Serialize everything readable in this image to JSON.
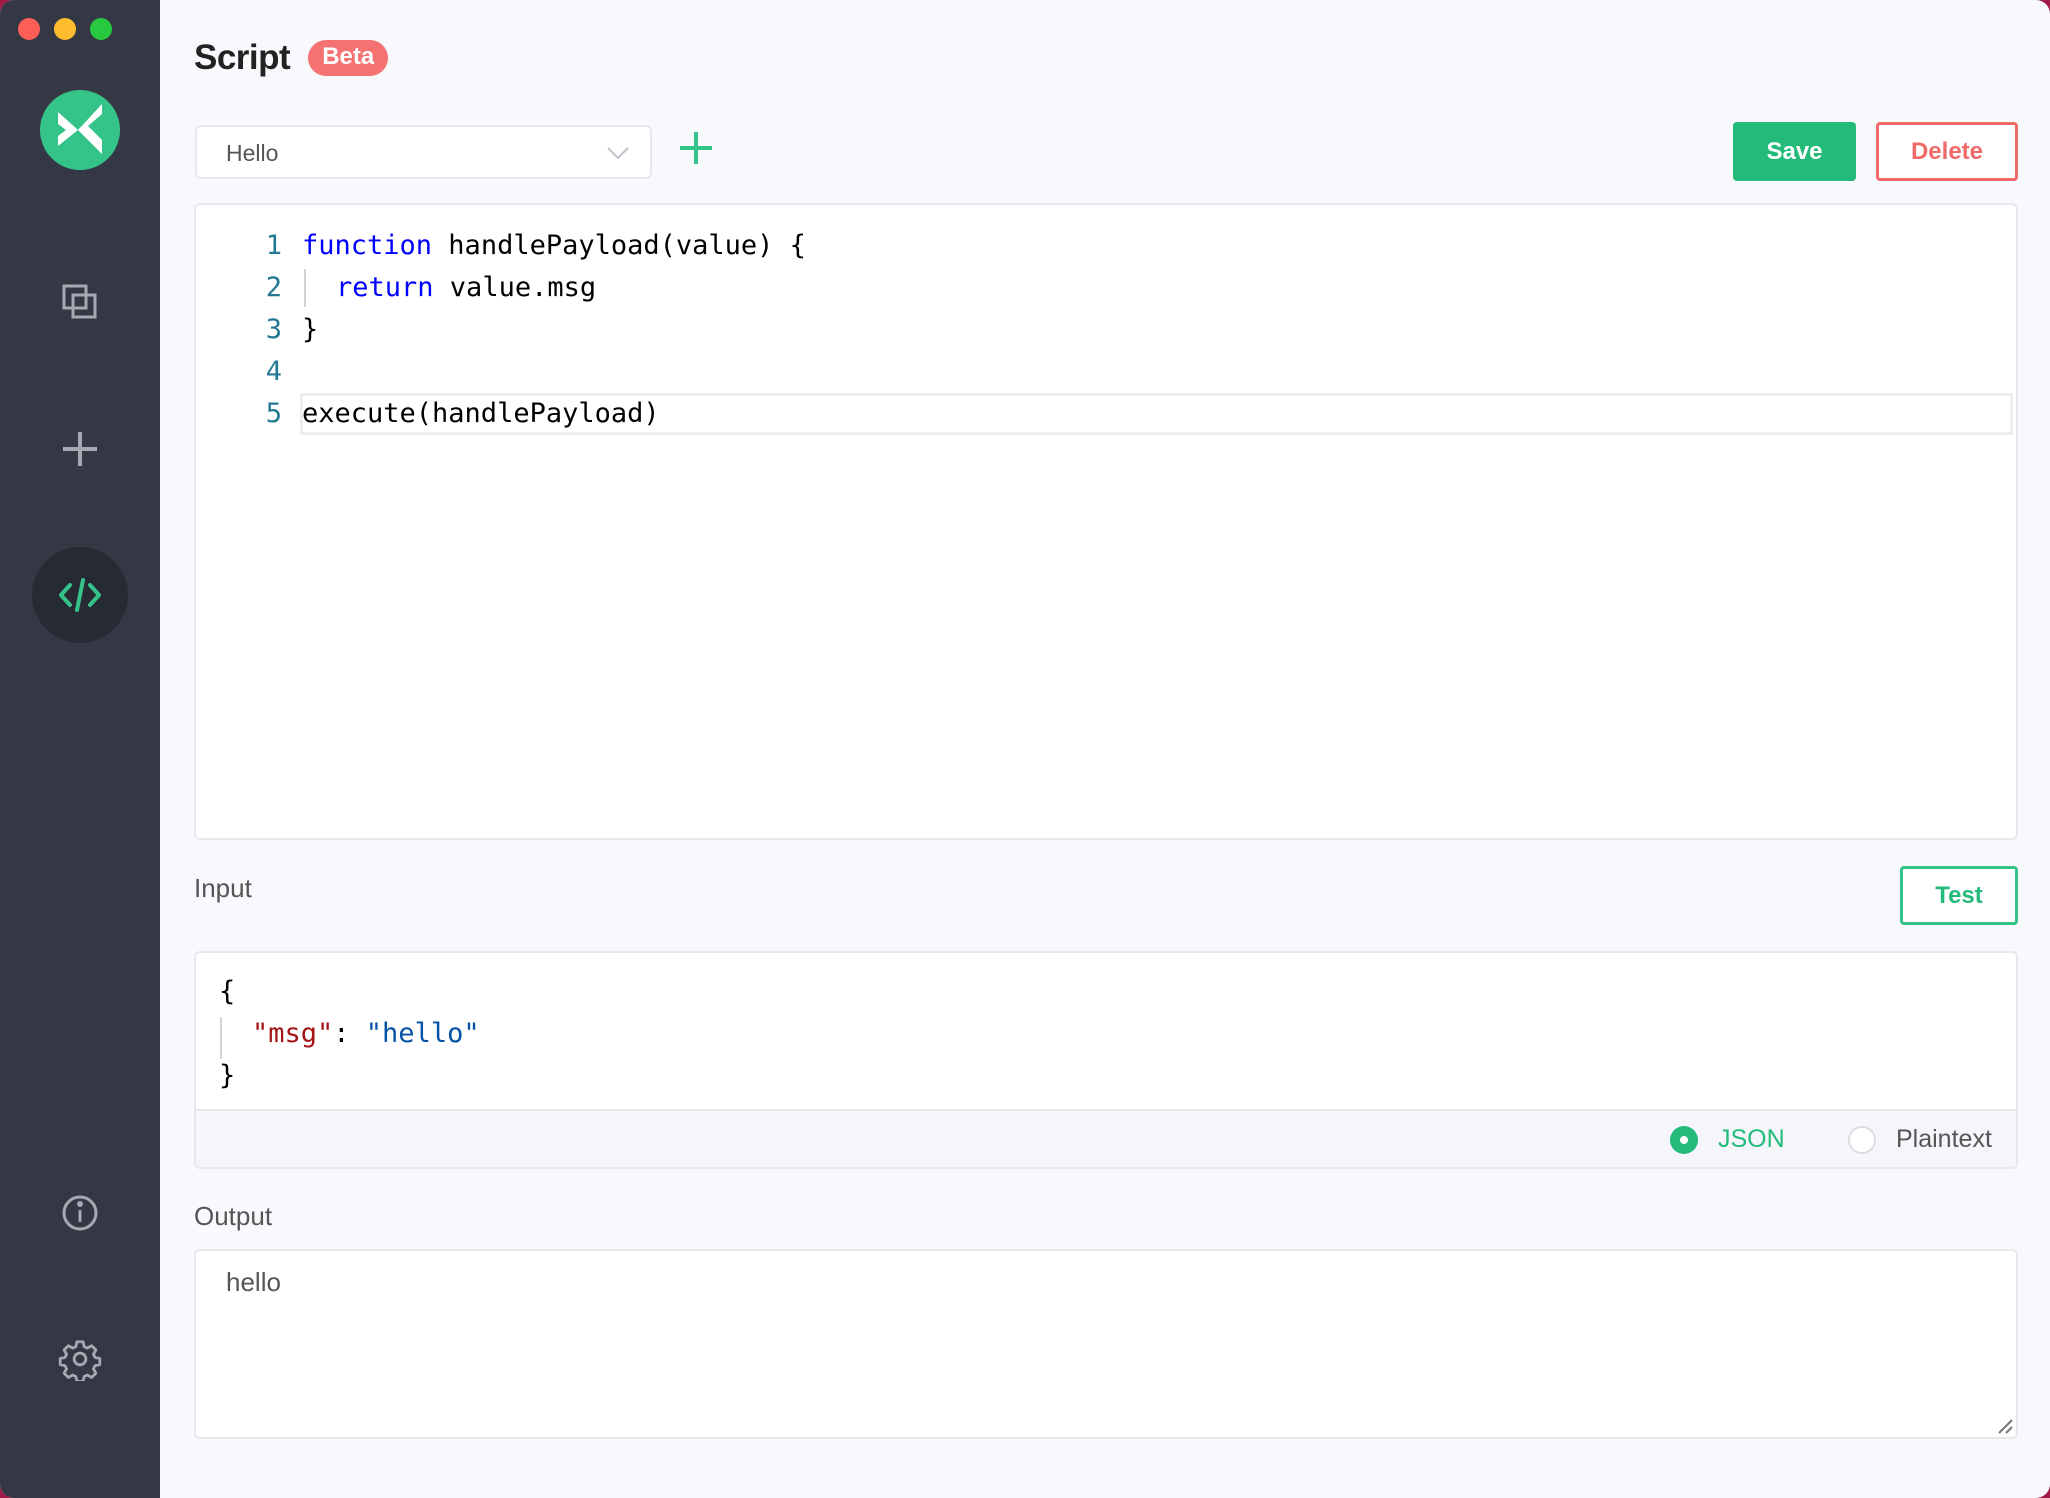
{
  "window": {
    "controls": [
      "close",
      "minimize",
      "maximize"
    ]
  },
  "sidebar": {
    "logo_icon": "mqttx-logo-icon",
    "items": [
      {
        "name": "connections",
        "icon": "copy-windows-icon",
        "active": false
      },
      {
        "name": "new-connection",
        "icon": "plus-icon",
        "active": false
      },
      {
        "name": "script",
        "icon": "code-icon",
        "active": true
      },
      {
        "name": "about",
        "icon": "info-icon",
        "active": false
      },
      {
        "name": "settings",
        "icon": "gear-icon",
        "active": false
      }
    ]
  },
  "header": {
    "title": "Script",
    "badge": "Beta"
  },
  "toolbar": {
    "script_select_value": "Hello",
    "add_icon": "plus-icon",
    "save_label": "Save",
    "delete_label": "Delete"
  },
  "editor": {
    "lines": [
      {
        "num": "1",
        "kw": "function",
        "rest": " handlePayload(value) {"
      },
      {
        "num": "2",
        "kw": "return",
        "rest": " value.msg"
      },
      {
        "num": "3",
        "kw": "",
        "rest": "}"
      },
      {
        "num": "4",
        "kw": "",
        "rest": ""
      },
      {
        "num": "5",
        "kw": "",
        "rest": "execute(handlePayload)"
      }
    ],
    "current_line": 5
  },
  "input": {
    "label": "Input",
    "test_label": "Test",
    "json": {
      "open": "{",
      "key": "\"msg\"",
      "colon": ": ",
      "value": "\"hello\"",
      "close": "}"
    },
    "formats": [
      {
        "label": "JSON",
        "selected": true
      },
      {
        "label": "Plaintext",
        "selected": false
      }
    ]
  },
  "output": {
    "label": "Output",
    "value": "hello"
  },
  "colors": {
    "accent": "#22bb7a",
    "danger": "#f06a6a",
    "sidebar": "#343845",
    "beta": "#f47272"
  }
}
